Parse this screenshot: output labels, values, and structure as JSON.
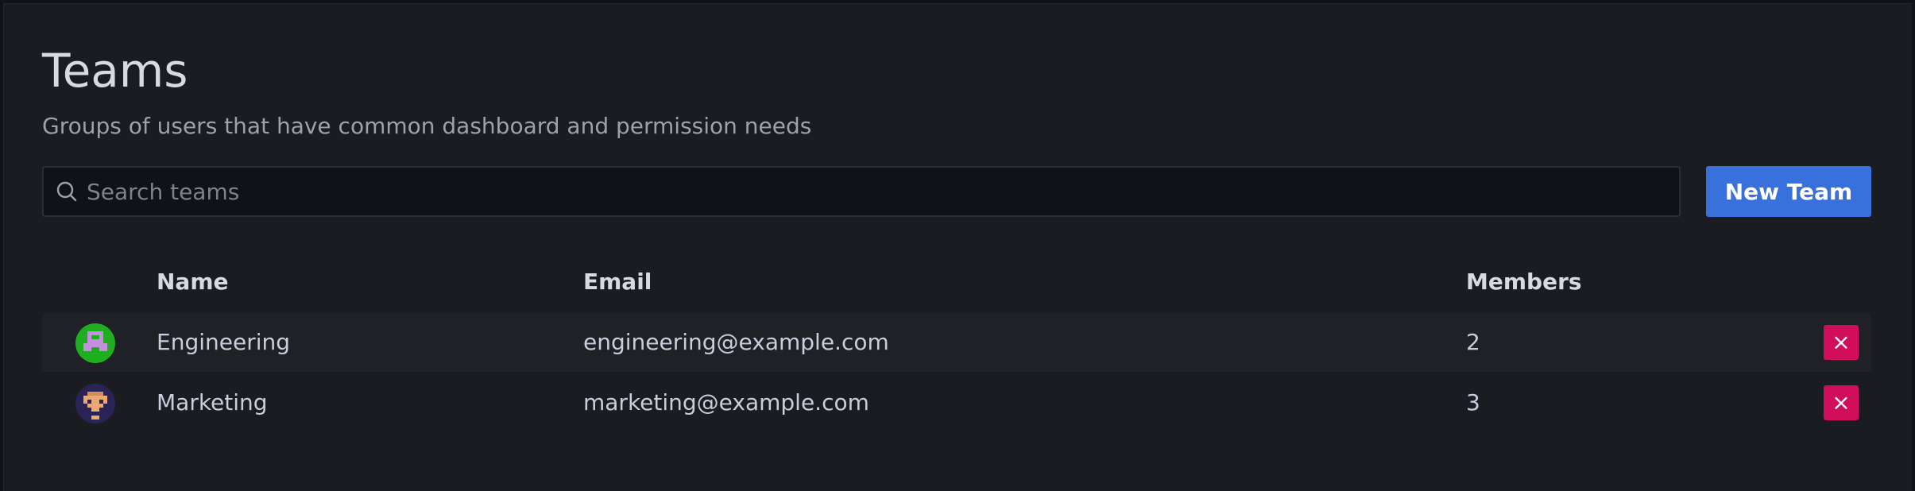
{
  "page": {
    "title": "Teams",
    "subtitle": "Groups of users that have common dashboard and permission needs"
  },
  "search": {
    "placeholder": "Search teams",
    "value": ""
  },
  "actions": {
    "new_team_label": "New Team"
  },
  "table": {
    "columns": [
      "Name",
      "Email",
      "Members"
    ],
    "rows": [
      {
        "name": "Engineering",
        "email": "engineering@example.com",
        "members": "2",
        "avatar": "engineering-avatar-icon"
      },
      {
        "name": "Marketing",
        "email": "marketing@example.com",
        "members": "3",
        "avatar": "marketing-avatar-icon"
      }
    ],
    "delete_label": "×"
  },
  "colors": {
    "background": "#1b1c21",
    "primary_button": "#3871dc",
    "delete_button": "#d10e5c"
  }
}
